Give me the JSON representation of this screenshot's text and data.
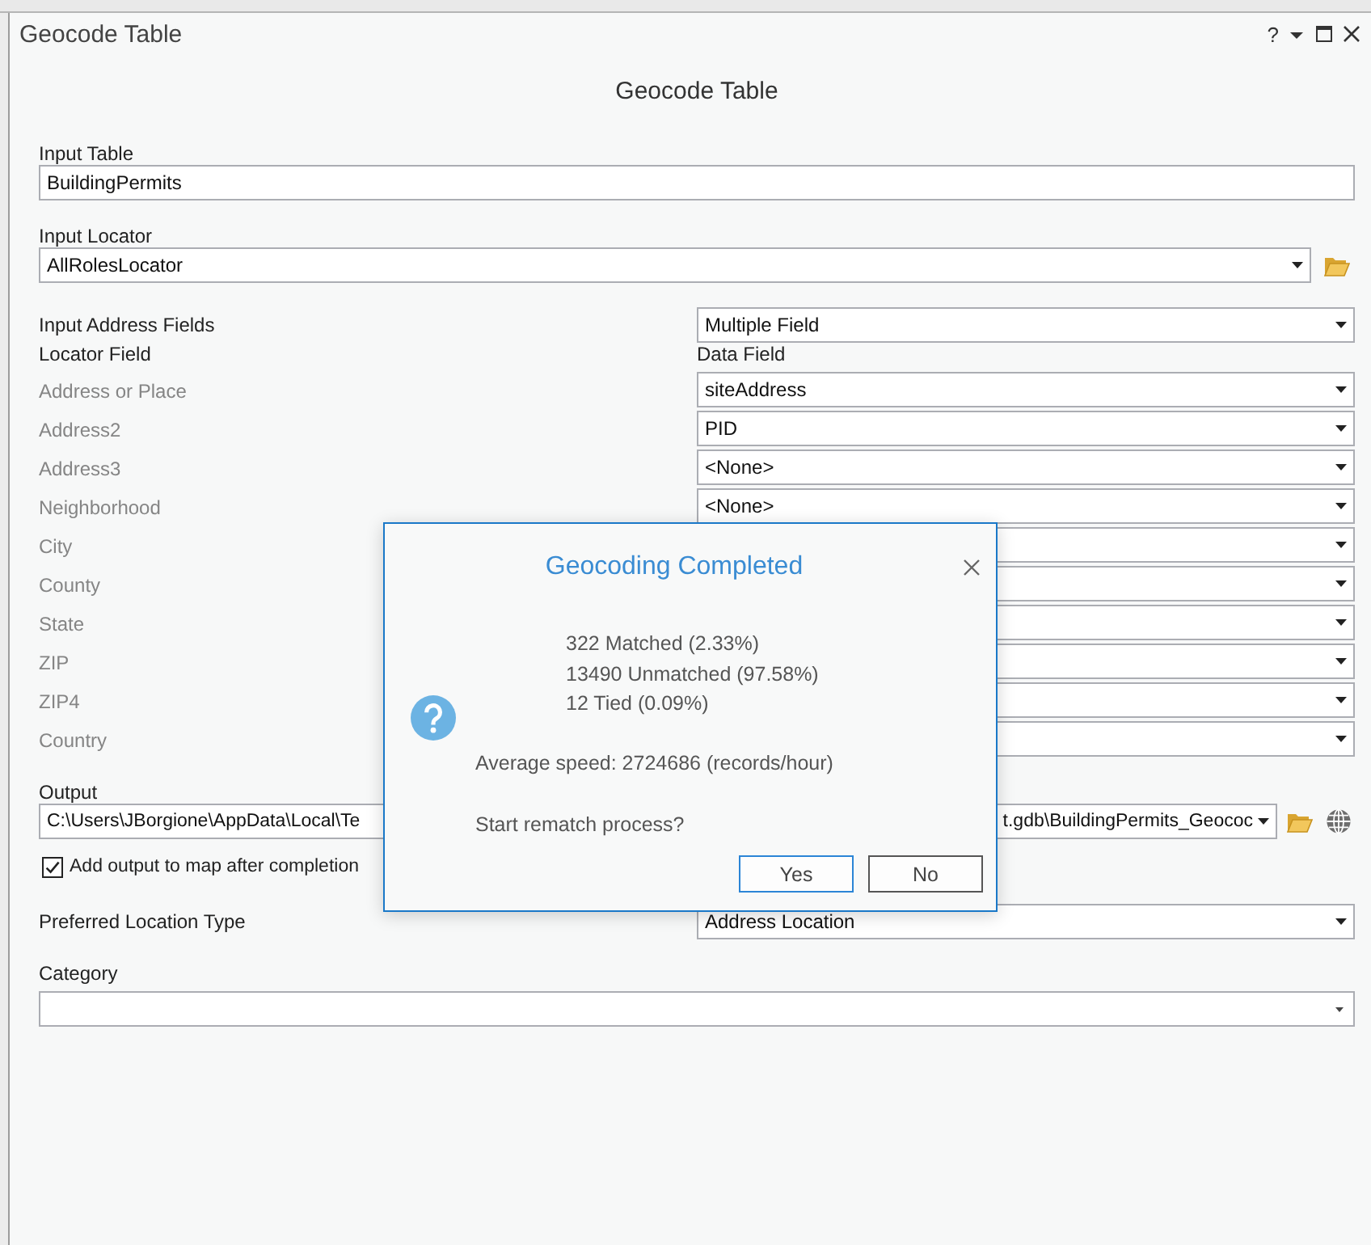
{
  "window": {
    "title": "Geocode Table",
    "help": "?"
  },
  "pane": {
    "title": "Geocode Table"
  },
  "input_table": {
    "label": "Input Table",
    "value": "BuildingPermits"
  },
  "input_locator": {
    "label": "Input Locator",
    "value": "AllRolesLocator"
  },
  "input_address_fields": {
    "label": "Input Address Fields",
    "value": "Multiple Field"
  },
  "field_map": {
    "columns": [
      "Locator Field",
      "Data Field"
    ],
    "rows": [
      {
        "name": "Address or Place",
        "value": "siteAddress"
      },
      {
        "name": "Address2",
        "value": "PID"
      },
      {
        "name": "Address3",
        "value": "<None>"
      },
      {
        "name": "Neighborhood",
        "value": "<None>"
      },
      {
        "name": "City"
      },
      {
        "name": "County"
      },
      {
        "name": "State"
      },
      {
        "name": "ZIP"
      },
      {
        "name": "ZIP4"
      },
      {
        "name": "Country"
      }
    ]
  },
  "output": {
    "label": "Output",
    "value_start": "C:\\Users\\JBorgione\\AppData\\Local\\Te",
    "value_end": "t.gdb\\BuildingPermits_Geococ"
  },
  "add_output": {
    "label": "Add output to map after completion",
    "checked": true
  },
  "preferred_location_type": {
    "label": "Preferred Location Type",
    "value": "Address Location"
  },
  "category": {
    "label": "Category"
  },
  "dialog": {
    "title": "Geocoding Completed",
    "stats": [
      "322 Matched (2.33%)",
      "13490 Unmatched (97.58%)",
      "12 Tied (0.09%)"
    ],
    "speed": "Average speed: 2724686 (records/hour)",
    "prompt": "Start rematch process?",
    "buttons": [
      {
        "label": "Yes",
        "focused": true
      },
      {
        "label": "No",
        "focused": false
      }
    ]
  }
}
